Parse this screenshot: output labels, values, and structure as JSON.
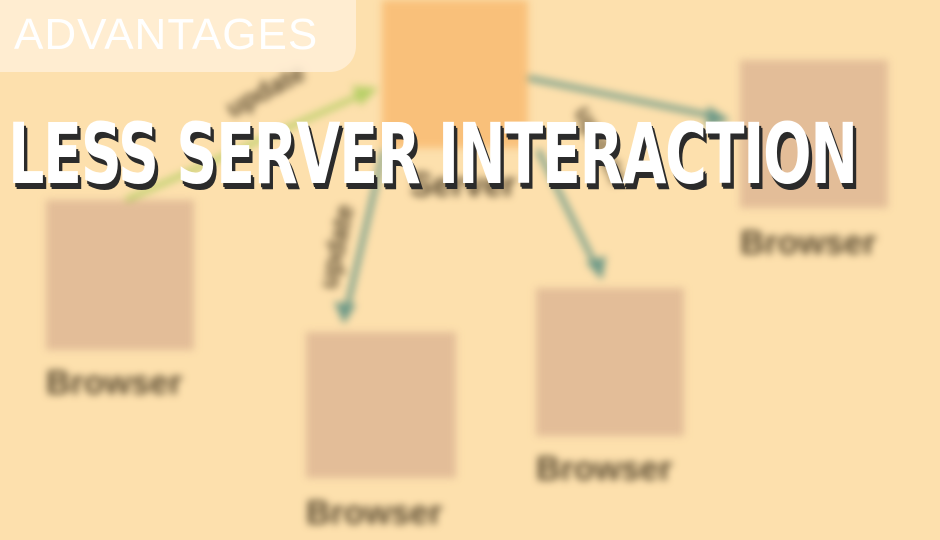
{
  "badge": {
    "text": "ADVANTAGES"
  },
  "headline": {
    "text": "LESS SERVER INTERACTION"
  },
  "diagram": {
    "server_label": "Server",
    "browser_label": "Browser",
    "update_label": "update",
    "colors": {
      "background": "#fde0ad",
      "server_box": "#f9c07a",
      "browser_box": "#e3bd98",
      "label_text": "#5a4a30",
      "arrow_in": "#b7cf67",
      "arrow_out": "#6f9a88"
    }
  }
}
